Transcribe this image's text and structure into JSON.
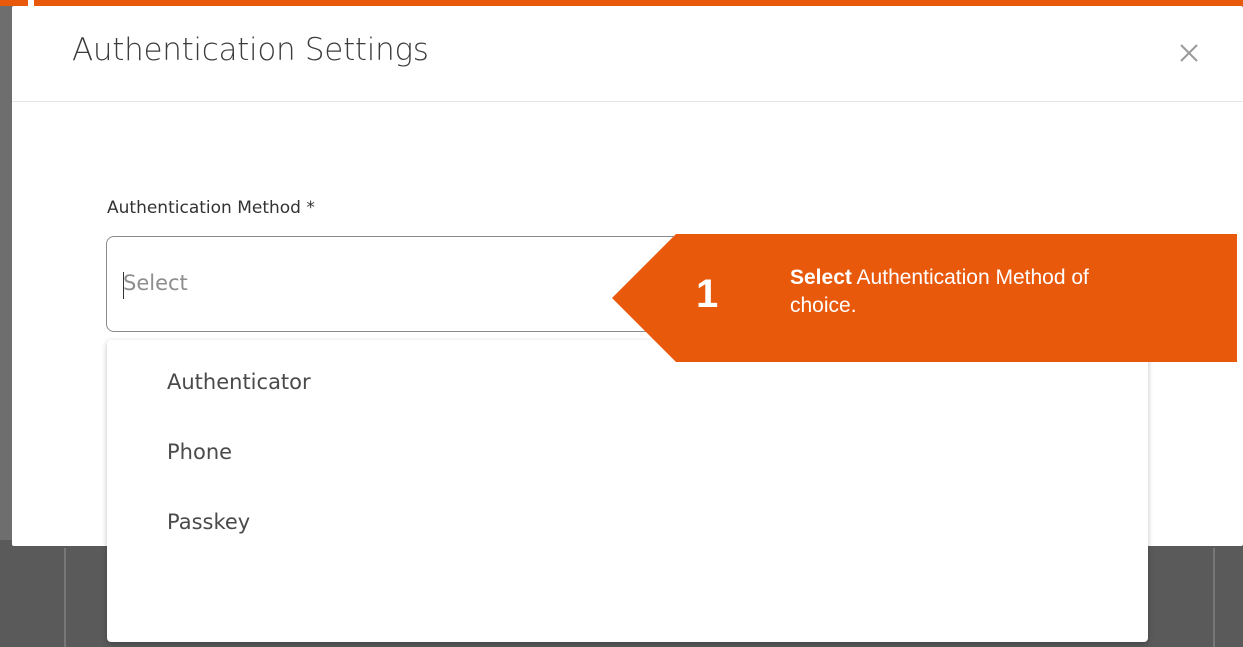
{
  "modal": {
    "title": "Authentication Settings"
  },
  "form": {
    "field_label": "Authentication Method *",
    "select_placeholder": "Select"
  },
  "dropdown": {
    "options": [
      "Authenticator",
      "Phone",
      "Passkey"
    ]
  },
  "callout": {
    "step_number": "1",
    "action_word": "Select",
    "text": " Authentication Method of choice."
  },
  "icons": {
    "close": "close-icon"
  },
  "colors": {
    "accent": "#e8590c",
    "overlay": "#6e6e6e",
    "modal_bg": "#ffffff"
  }
}
